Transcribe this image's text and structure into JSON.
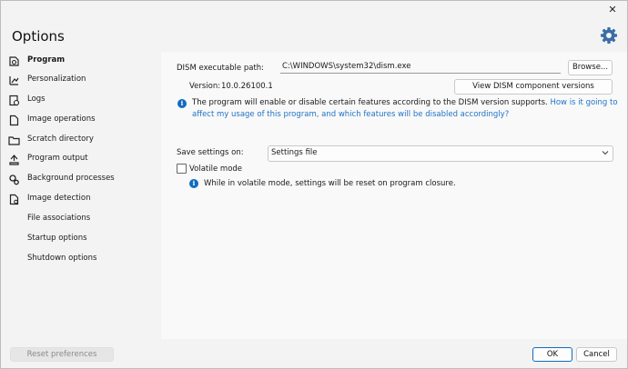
{
  "window": {
    "title": "Options",
    "close_glyph": "✕"
  },
  "sidebar": {
    "items": [
      {
        "label": "Program",
        "icon": "program-icon",
        "active": true
      },
      {
        "label": "Personalization",
        "icon": "personalization-icon"
      },
      {
        "label": "Logs",
        "icon": "logs-icon"
      },
      {
        "label": "Image operations",
        "icon": "image-operations-icon"
      },
      {
        "label": "Scratch directory",
        "icon": "folder-icon"
      },
      {
        "label": "Program output",
        "icon": "program-output-icon"
      },
      {
        "label": "Background processes",
        "icon": "gears-icon"
      },
      {
        "label": "Image detection",
        "icon": "image-detection-icon"
      },
      {
        "label": "File associations",
        "icon": ""
      },
      {
        "label": "Startup options",
        "icon": ""
      },
      {
        "label": "Shutdown options",
        "icon": ""
      }
    ]
  },
  "program": {
    "dism_path_label": "DISM executable path:",
    "dism_path_value": "C:\\WINDOWS\\system32\\dism.exe",
    "browse_label": "Browse...",
    "version_label": "Version:",
    "version_value": "10.0.26100.1",
    "view_components_label": "View DISM component versions",
    "info_text": "The program will enable or disable certain features according to the DISM version supports.",
    "info_link": "How is it going to affect my usage of this program, and which features will be disabled accordingly?",
    "save_settings_label": "Save settings on:",
    "save_settings_value": "Settings file",
    "volatile_label": "Volatile mode",
    "volatile_checked": false,
    "volatile_info": "While in volatile mode, settings will be reset on program closure."
  },
  "footer": {
    "reset_label": "Reset preferences",
    "ok_label": "OK",
    "cancel_label": "Cancel"
  },
  "colors": {
    "accent": "#0f6cbd",
    "link": "#1f73c7"
  }
}
